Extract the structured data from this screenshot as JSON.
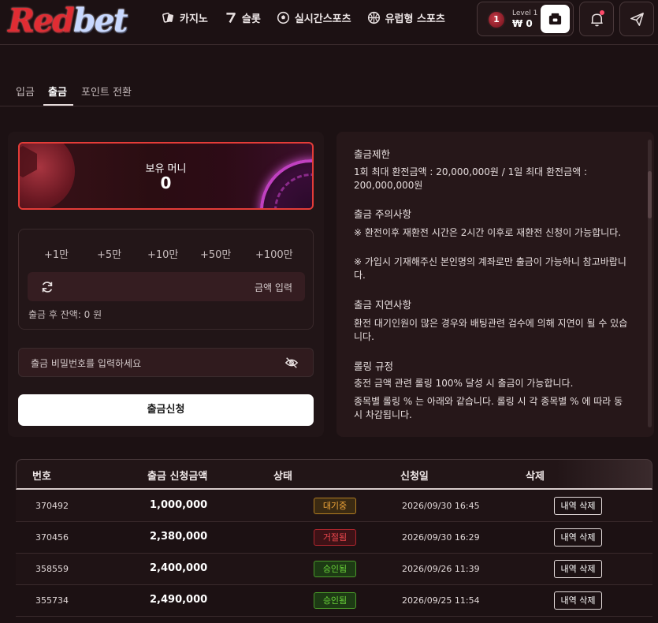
{
  "header": {
    "logo_red": "Red",
    "logo_blue": "bet",
    "nav": [
      {
        "label": "카지노",
        "icon": "casino-chip-icon"
      },
      {
        "label": "슬롯",
        "icon": "seven-slot-icon"
      },
      {
        "label": "실시간스포츠",
        "icon": "soccer-ball-icon"
      },
      {
        "label": "유럽형 스포츠",
        "icon": "basketball-icon"
      }
    ],
    "user": {
      "level_number": "1",
      "level_label": "Level 1",
      "balance": "₩ 0"
    }
  },
  "tabs": [
    {
      "label": "입금",
      "active": false
    },
    {
      "label": "출금",
      "active": true
    },
    {
      "label": "포인트 전환",
      "active": false
    }
  ],
  "withdraw": {
    "money_label": "보유 머니",
    "money_value": "0",
    "quick_amounts": [
      "+1만",
      "+5만",
      "+10만",
      "+50만",
      "+100만"
    ],
    "amount_placeholder": "금액 입력",
    "after_balance": "출금 후 잔액: 0 원",
    "password_placeholder": "출금 비밀번호를 입력하세요",
    "submit_label": "출금신청"
  },
  "notice": {
    "limit_title": "출금제한",
    "limit_text": "1회 최대 환전금액 : 20,000,000원 / 1일 최대 환전금액 : 200,000,000원",
    "caution_title": "출금 주의사항",
    "caution_1": "※ 환전이후 재환전 시간은 2시간 이후로 재환전 신청이 가능합니다.",
    "caution_2": "※ 가입시 기재해주신 본인명의 계좌로만 출금이 가능하니 참고바랍니다.",
    "delay_title": "출금 지연사항",
    "delay_text": "환전 대기인원이 많은 경우와 배팅관련 검수에 의해 지연이 될 수 있습니다.",
    "rolling_title": "롤링 규정",
    "rolling_1": "충전 금액 관련 롤링 100% 달성 시 출금이 가능합니다.",
    "rolling_2": "종목별 롤링 % 는 아래와 같습니다. 롤링 시 각 종목별 % 에 따라 동시 차감됩니다."
  },
  "table": {
    "headers": [
      "번호",
      "출금 신청금액",
      "상태",
      "신청일",
      "삭제"
    ],
    "rows": [
      {
        "no": "370492",
        "amount": "1,000,000",
        "status": "대기중",
        "status_type": "waiting",
        "date": "2026/09/30 16:45",
        "action": "내역 삭제"
      },
      {
        "no": "370456",
        "amount": "2,380,000",
        "status": "거절됨",
        "status_type": "rejected",
        "date": "2026/09/30 16:29",
        "action": "내역 삭제"
      },
      {
        "no": "358559",
        "amount": "2,400,000",
        "status": "승인됨",
        "status_type": "approved",
        "date": "2026/09/26 11:39",
        "action": "내역 삭제"
      },
      {
        "no": "355734",
        "amount": "2,490,000",
        "status": "승인됨",
        "status_type": "approved",
        "date": "2026/09/25 11:54",
        "action": "내역 삭제"
      }
    ]
  },
  "colors": {
    "background": "#1c1113",
    "accent_red": "#e43c38",
    "waiting": "#f0a63a",
    "rejected": "#f0484e",
    "approved": "#6ad43a"
  }
}
